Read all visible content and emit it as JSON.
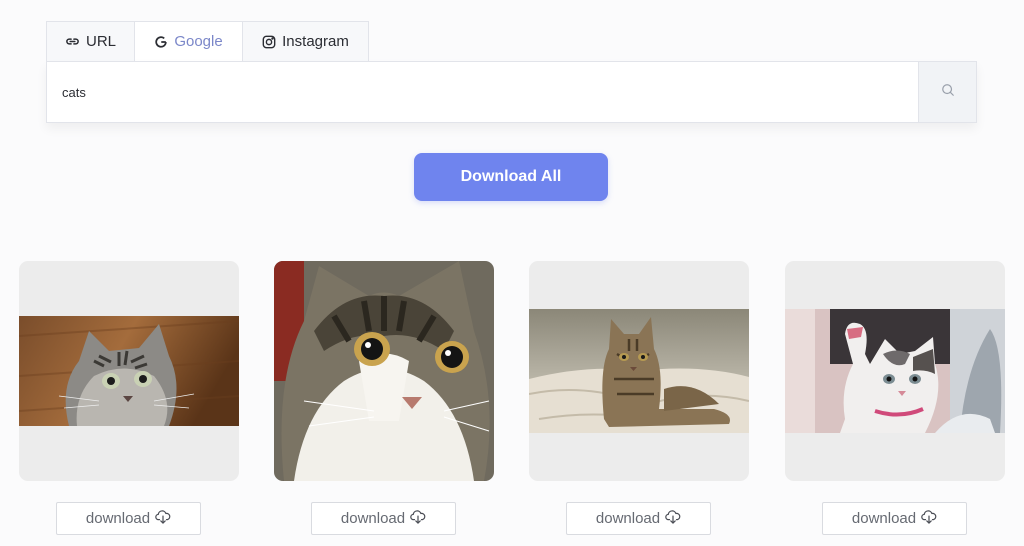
{
  "tabs": [
    {
      "label": "URL",
      "icon": "link-icon"
    },
    {
      "label": "Google",
      "icon": "google-g-icon",
      "active": true
    },
    {
      "label": "Instagram",
      "icon": "instagram-icon"
    }
  ],
  "search": {
    "value": "cats",
    "button_icon": "search-icon"
  },
  "download_all_label": "Download All",
  "accent_color": "#6f84ee",
  "results": [
    {
      "subject": "tabby kitten on wooden floor",
      "download_label": "download"
    },
    {
      "subject": "close-up of kitten face",
      "download_label": "download"
    },
    {
      "subject": "tabby cat lying on blanket",
      "download_label": "download"
    },
    {
      "subject": "white kitten raising paw",
      "download_label": "download"
    }
  ]
}
